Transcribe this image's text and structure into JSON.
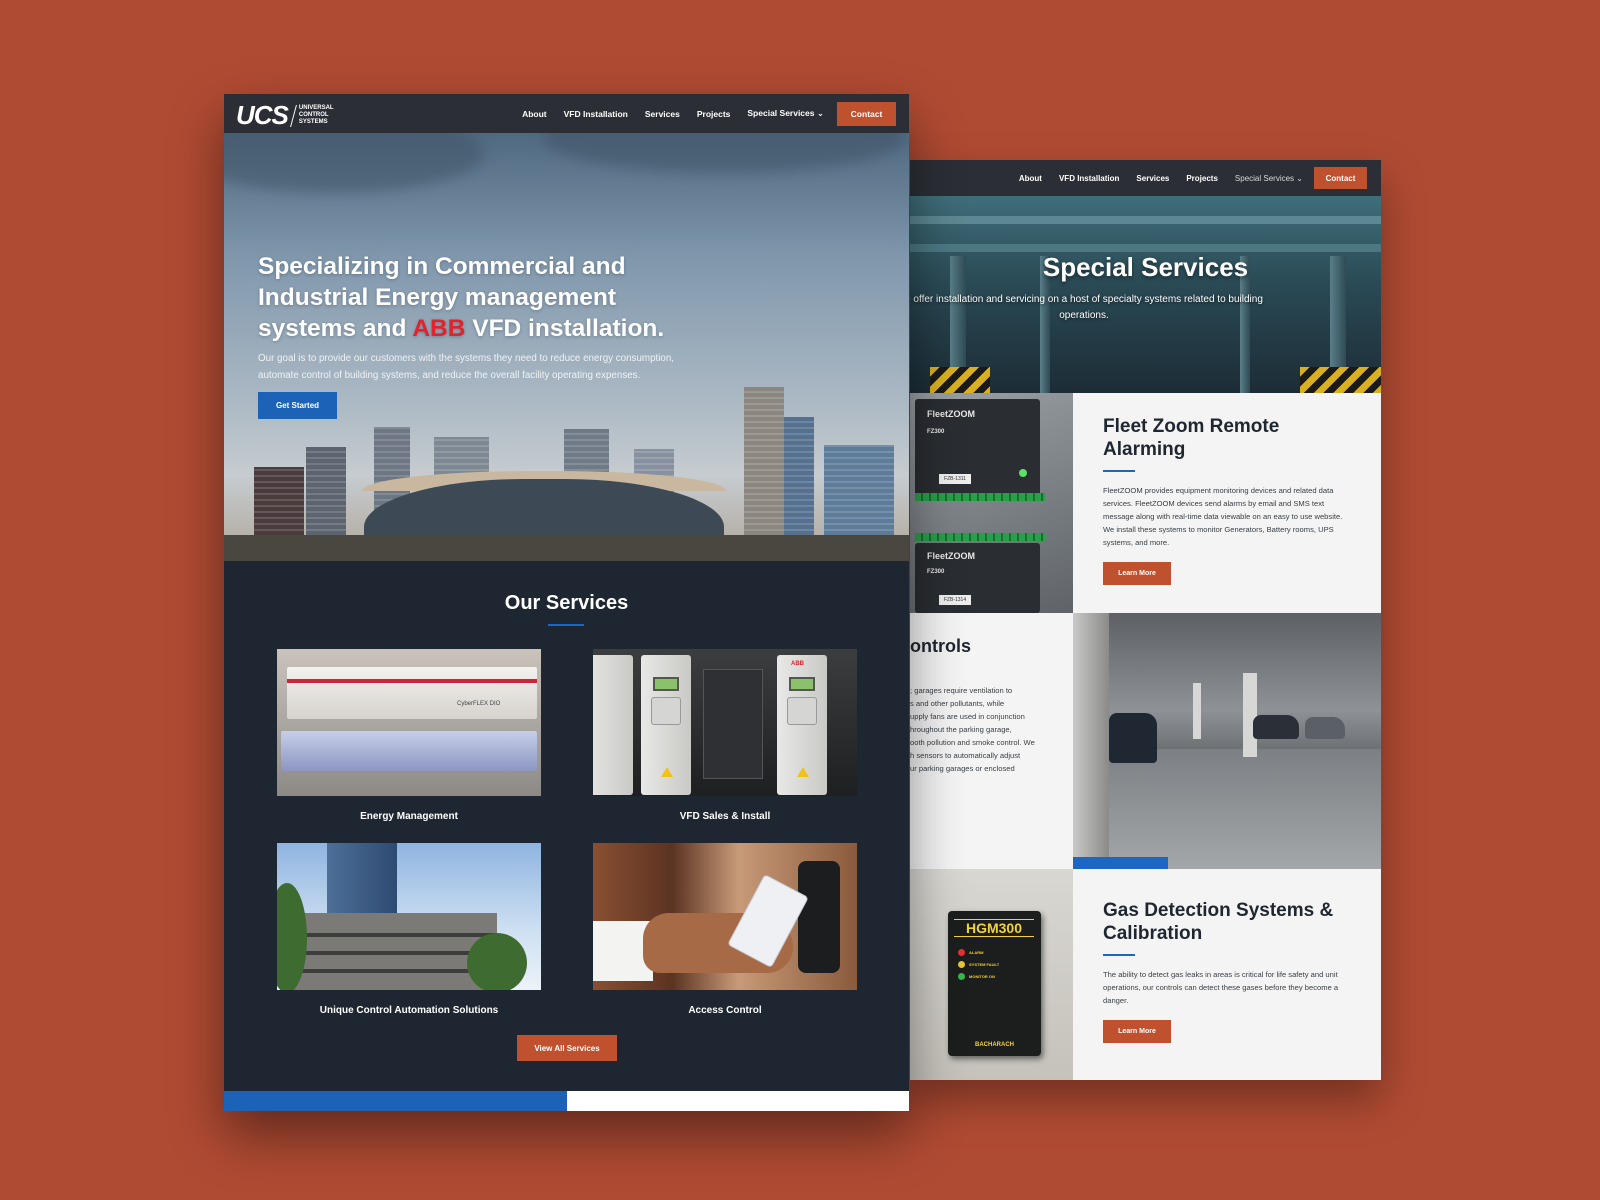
{
  "right_page": {
    "nav": {
      "items": [
        "About",
        "VFD Installation",
        "Services",
        "Projects"
      ],
      "special": "Special Services",
      "contact": "Contact"
    },
    "hero": {
      "title": "Special Services",
      "subtitle": "e offer installation and servicing on a host of specialty systems related to building operations."
    },
    "sections": [
      {
        "heading": "Fleet Zoom Remote Alarming",
        "body": "FleetZOOM provides equipment monitoring devices and related data services. FleetZOOM devices send alarms by email and SMS text message along with real-time data viewable on an easy to use website. We install these systems to monitor Generators, Battery rooms, UPS systems, and more.",
        "button": "Learn More",
        "image_labels": [
          "FleetZOOM",
          "FZ300",
          "FZB-1311",
          "FleetZOOM",
          "FZ300",
          "FZB-1314"
        ]
      },
      {
        "heading": "ontrols",
        "body_lines": [
          "; garages require ventilation to",
          "s and other pollutants, while",
          "upply fans are used in conjunction",
          "hroughout the parking garage,",
          "ooth pollution and smoke control. We",
          "h sensors to automatically adjust",
          "ur parking garages or enclosed"
        ]
      },
      {
        "heading": "Gas Detection Systems & Calibration",
        "body": "The ability to detect gas leaks in areas is critical for life safety and unit operations, our controls can detect these gases before they become a danger.",
        "button": "Learn More",
        "device": {
          "model": "HGM300",
          "brand": "BACHARACH",
          "leds": [
            "ALARM",
            "SYSTEM FAULT",
            "MONITOR ON"
          ]
        }
      }
    ]
  },
  "left_page": {
    "logo": {
      "mark": "UCS",
      "text_lines": [
        "UNIVERSAL",
        "CONTROL",
        "SYSTEMS"
      ]
    },
    "nav": {
      "items": [
        "About",
        "VFD Installation",
        "Services",
        "Projects"
      ],
      "special": "Special Services",
      "contact": "Contact"
    },
    "hero": {
      "title_before": "Specializing in Commercial and Industrial Energy management systems and ",
      "title_highlight": "ABB",
      "title_after": " VFD installation.",
      "subtitle": "Our goal is to provide our customers with the systems they need to reduce energy consumption, automate control of building systems, and reduce the overall facility operating expenses.",
      "button": "Get Started"
    },
    "services": {
      "title": "Our Services",
      "items": [
        {
          "label": "Energy Management",
          "image_text": "CyberFLEX DIO"
        },
        {
          "label": "VFD Sales & Install",
          "image_text": "ABB"
        },
        {
          "label": "Unique Control Automation Solutions"
        },
        {
          "label": "Access Control"
        }
      ],
      "button": "View All Services"
    }
  },
  "colors": {
    "background": "#b04b33",
    "nav": "#2b2f35",
    "accent_orange": "#c0512f",
    "accent_blue": "#1c63b8",
    "dark_section": "#1e2731",
    "abb_red": "#e0242e"
  }
}
